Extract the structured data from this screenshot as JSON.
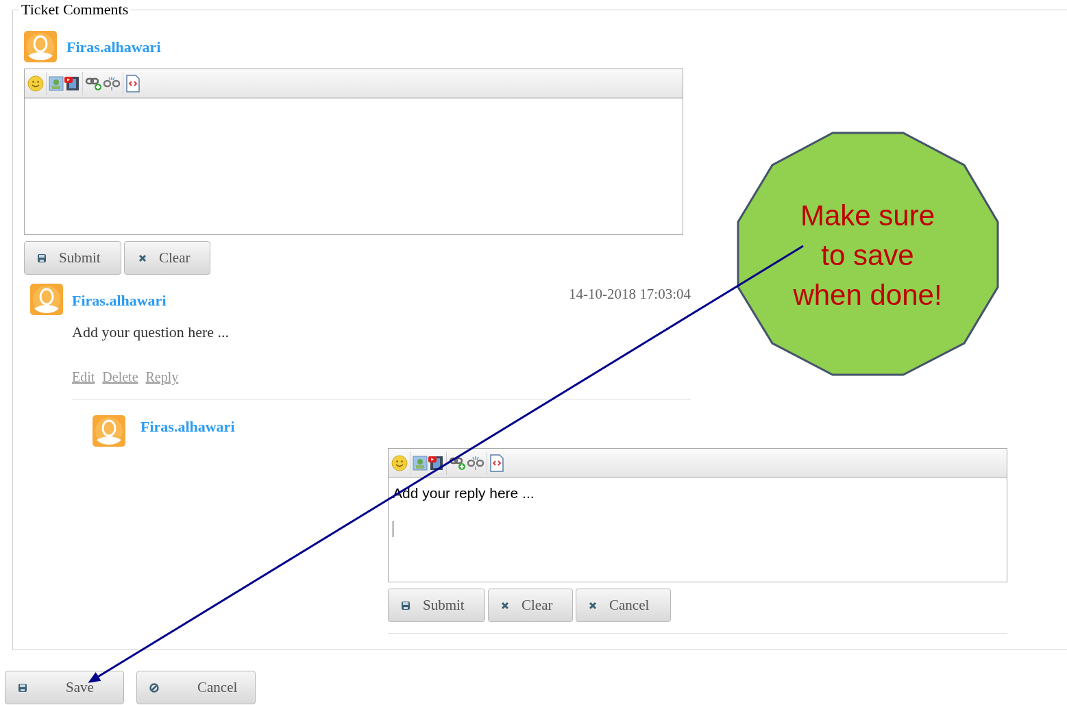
{
  "section": {
    "title": "Ticket Comments"
  },
  "composer": {
    "author": "Firas.alhawari",
    "buttons": [
      {
        "label": "Submit",
        "kind": "submit"
      },
      {
        "label": "Clear",
        "kind": "clear"
      }
    ]
  },
  "comments": [
    {
      "author": "Firas.alhawari",
      "date": "14-10-2018 17:03:04",
      "body": "Add your question here ...",
      "actions": [
        "Edit",
        "Delete",
        "Reply"
      ]
    }
  ],
  "reply": {
    "author": "Firas.alhawari",
    "value": "Add your reply here ...",
    "buttons": [
      {
        "label": "Submit",
        "kind": "submit"
      },
      {
        "label": "Clear",
        "kind": "clear"
      },
      {
        "label": "Cancel",
        "kind": "clear"
      }
    ]
  },
  "form_buttons": [
    {
      "label": "Save",
      "kind": "submit"
    },
    {
      "label": "Cancel",
      "kind": "cancel"
    }
  ],
  "callout": {
    "lines": [
      "Make sure",
      "to save",
      "when done!"
    ]
  }
}
